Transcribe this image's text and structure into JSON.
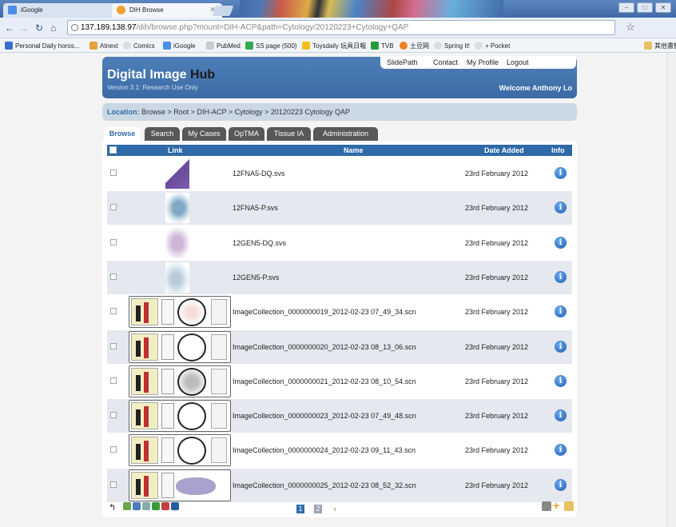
{
  "browser": {
    "tabs": [
      {
        "label": "iGoogle"
      },
      {
        "label": "DIH Browse"
      }
    ],
    "url_host": "137.189.138.97",
    "url_path": "/dih/browse.php?mount=DIH-ACP&path=Cytology/20120223+Cytology+QAP",
    "bookmarks": [
      "Personal Daily horos...",
      "Atnext",
      "Comics",
      "iGoogle",
      "PubMed",
      "SS page (500)",
      "Toysdaily 玩具日報",
      "TVB",
      "土豆网",
      "Spring It!",
      "+ Pocket"
    ],
    "other_bookmarks": "其他書籤"
  },
  "top_nav": {
    "items": [
      "SlidePath",
      "Contact",
      "My Profile",
      "Logout"
    ]
  },
  "header": {
    "title_main": "Digital Image",
    "title_accent": "Hub",
    "version": "Version 3.1: Research Use Only",
    "welcome": "Welcome Anthony Lo"
  },
  "location": {
    "label": "Location:",
    "path": "Browse > Root > DIH-ACP > Cytology > 20120223 Cytology QAP"
  },
  "tabs": [
    "Browse",
    "Search",
    "My Cases",
    "OpTMA",
    "Tissue IA",
    "Administration"
  ],
  "table": {
    "headers": {
      "link": "Link",
      "name": "Name",
      "date": "Date Added",
      "info": "Info"
    },
    "rows": [
      {
        "name": "12FNA5-DQ.svs",
        "date": "23rd February 2012",
        "thumb": "purple-wedge"
      },
      {
        "name": "12FNA5-P.svs",
        "date": "23rd February 2012",
        "thumb": "pap-smear"
      },
      {
        "name": "12GEN5-DQ.svs",
        "date": "23rd February 2012",
        "thumb": "light-purple"
      },
      {
        "name": "12GEN5-P.svs",
        "date": "23rd February 2012",
        "thumb": "faint-blue"
      },
      {
        "name": "ImageCollection_0000000019_2012-02-23 07_49_34.scn",
        "date": "23rd February 2012",
        "thumb": "slide-red"
      },
      {
        "name": "ImageCollection_0000000020_2012-02-23 08_13_06.scn",
        "date": "23rd February 2012",
        "thumb": "slide-plain"
      },
      {
        "name": "ImageCollection_0000000021_2012-02-23 08_10_54.scn",
        "date": "23rd February 2012",
        "thumb": "slide-dense"
      },
      {
        "name": "ImageCollection_0000000023_2012-02-23 07_49_48.scn",
        "date": "23rd February 2012",
        "thumb": "slide-plain"
      },
      {
        "name": "ImageCollection_0000000024_2012-02-23 09_11_43.scn",
        "date": "23rd February 2012",
        "thumb": "slide-plain"
      },
      {
        "name": "ImageCollection_0000000025_2012-02-23 08_52_32.scn",
        "date": "23rd February 2012",
        "thumb": "slide-tissue"
      }
    ],
    "info_glyph": "i"
  },
  "pager": {
    "pages": [
      "1",
      "2"
    ],
    "current": "1",
    "next": "›"
  },
  "colors": {
    "header_blue": "#3c6aa6",
    "accent": "#2f6aa8",
    "row_alt": "#e5e8ee",
    "tab_dark": "#585858"
  }
}
